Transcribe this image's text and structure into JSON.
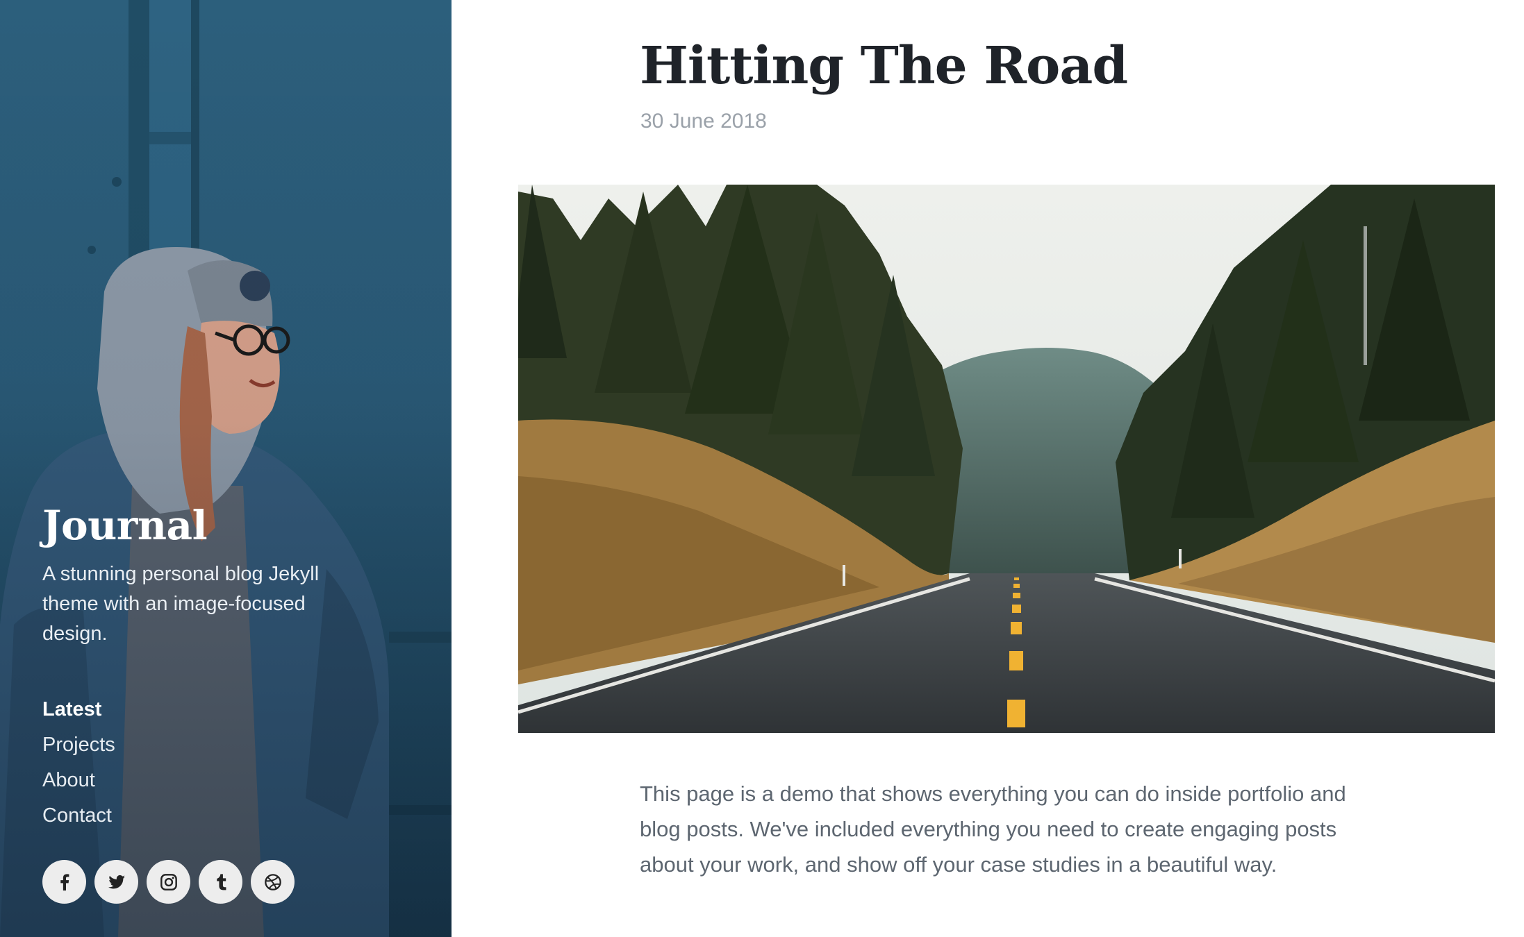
{
  "sidebar": {
    "title": "Journal",
    "tagline": "A stunning personal blog Jekyll theme with an image-focused design.",
    "nav": [
      {
        "label": "Latest",
        "active": true
      },
      {
        "label": "Projects",
        "active": false
      },
      {
        "label": "About",
        "active": false
      },
      {
        "label": "Contact",
        "active": false
      }
    ],
    "socials": [
      {
        "icon": "facebook-icon"
      },
      {
        "icon": "twitter-icon"
      },
      {
        "icon": "instagram-icon"
      },
      {
        "icon": "tumblr-icon"
      },
      {
        "icon": "dribbble-icon"
      }
    ]
  },
  "post": {
    "title": "Hitting The Road",
    "date": "30 June 2018",
    "body": "This page is a demo that shows everything you can do inside portfolio and blog posts. We've included everything you need to create engaging posts about your work, and show off your case studies in a beautiful way."
  },
  "colors": {
    "sidebar_background": "#2a5a77",
    "title_text": "#1f2329",
    "date_text": "#9aa1a9",
    "body_text": "#5d6670",
    "social_button": "#ededed",
    "road_line": "#f0b232"
  }
}
